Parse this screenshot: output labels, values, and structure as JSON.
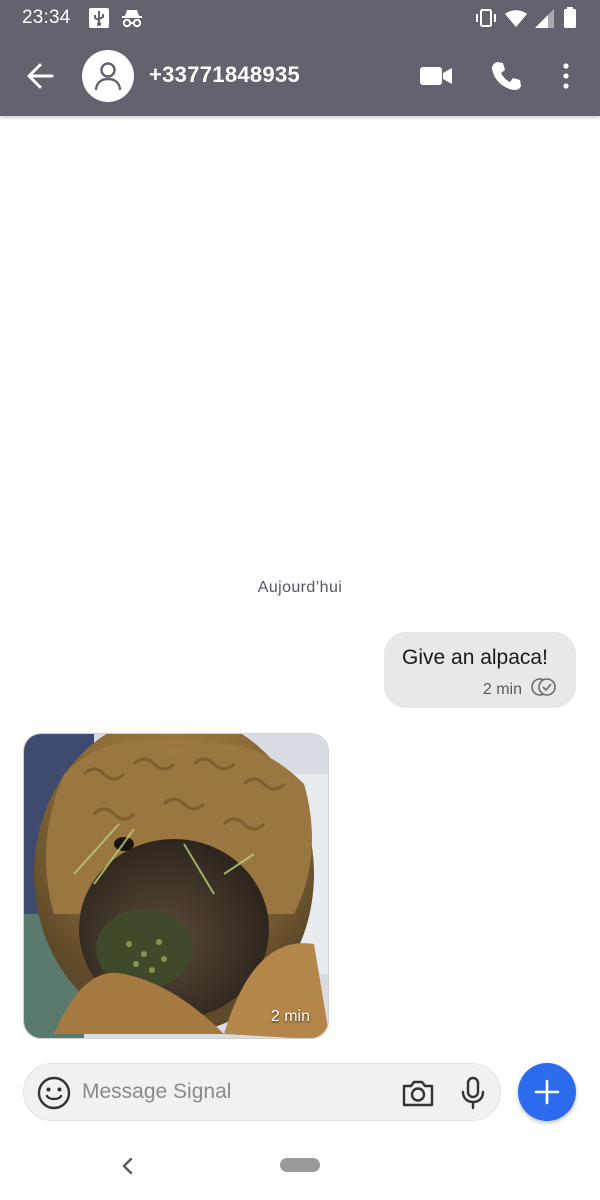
{
  "status_bar": {
    "time": "23:34",
    "left_icons": [
      "usb-icon",
      "incognito-icon"
    ],
    "right_icons": [
      "vibrate-icon",
      "wifi-icon",
      "cell-signal-icon",
      "battery-icon"
    ]
  },
  "header": {
    "back_icon": "arrow-left-icon",
    "avatar_icon": "person-icon",
    "contact_name": "+33771848935",
    "actions": [
      "video-call-icon",
      "phone-icon",
      "more-vert-icon"
    ],
    "background_color": "#63636f"
  },
  "conversation": {
    "date_divider": "Aujourd’hui",
    "messages": [
      {
        "direction": "outgoing",
        "type": "text",
        "text": "Give an alpaca!",
        "time": "2 min",
        "status_icon": "delivered-check-icon"
      },
      {
        "direction": "incoming",
        "type": "image",
        "image_subject": "alpaca photo",
        "time": "2 min"
      }
    ]
  },
  "composer": {
    "emoji_icon": "emoji-icon",
    "placeholder": "Message Signal",
    "camera_icon": "camera-icon",
    "mic_icon": "mic-icon",
    "attach_icon": "plus-icon",
    "accent_color": "#2c6bed"
  },
  "nav_bar": {
    "back_icon": "nav-back-icon",
    "home_pill": "home-pill"
  }
}
